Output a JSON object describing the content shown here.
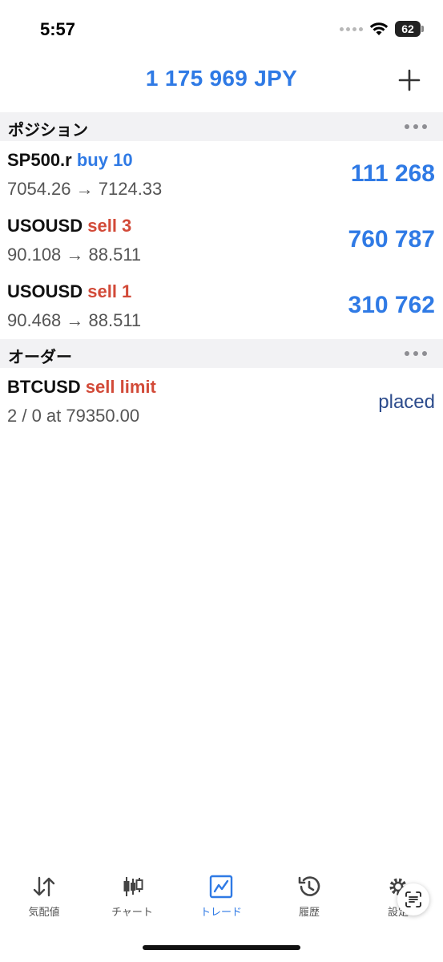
{
  "status_bar": {
    "time": "5:57",
    "battery": "62"
  },
  "header": {
    "balance": "1 175 969 JPY",
    "add_icon": "plus-icon"
  },
  "positions": {
    "title": "ポジション",
    "rows": [
      {
        "symbol": "SP500.r",
        "side": "buy 10",
        "side_type": "buy",
        "prices": "7054.26 → 7124.33",
        "profit": "111 268"
      },
      {
        "symbol": "USOUSD",
        "side": "sell 3",
        "side_type": "sell",
        "prices": "90.108 → 88.511",
        "profit": "760 787"
      },
      {
        "symbol": "USOUSD",
        "side": "sell 1",
        "side_type": "sell",
        "prices": "90.468 → 88.511",
        "profit": "310 762"
      }
    ]
  },
  "orders": {
    "title": "オーダー",
    "rows": [
      {
        "symbol": "BTCUSD",
        "side": "sell limit",
        "side_type": "sell",
        "details": "2 / 0 at 79350.00",
        "status": "placed"
      }
    ]
  },
  "tabs": [
    {
      "label": "気配値",
      "icon": "quotes-icon",
      "active": false
    },
    {
      "label": "チャート",
      "icon": "chart-icon",
      "active": false
    },
    {
      "label": "トレード",
      "icon": "trade-icon",
      "active": true
    },
    {
      "label": "履歴",
      "icon": "history-icon",
      "active": false
    },
    {
      "label": "設定",
      "icon": "settings-icon",
      "active": false
    }
  ],
  "colors": {
    "accent": "#2f7ae5",
    "sell": "#d24a38",
    "placed": "#2d4c8c",
    "section_bg": "#f2f2f4"
  }
}
